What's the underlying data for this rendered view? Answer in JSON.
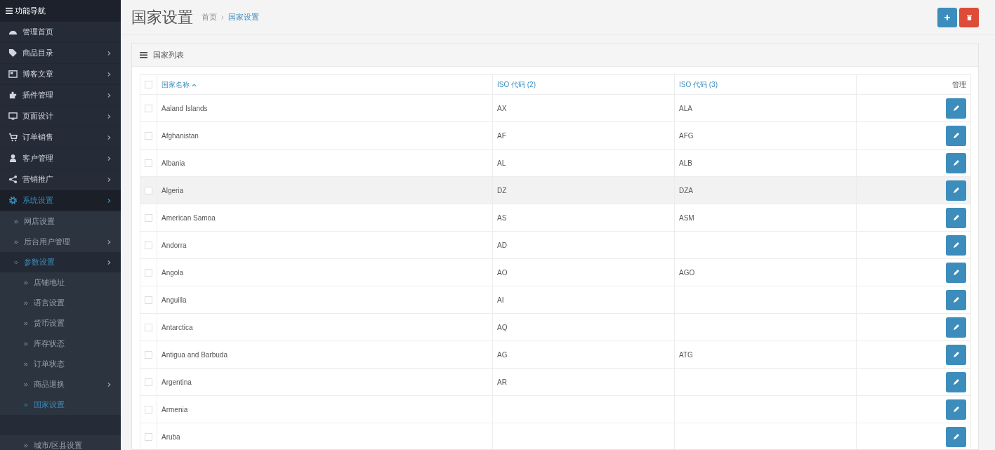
{
  "sidebar": {
    "title": "功能导航",
    "items": [
      {
        "label": "管理首页",
        "expandable": false,
        "selected": false
      },
      {
        "label": "商品目录",
        "expandable": true,
        "selected": false
      },
      {
        "label": "博客文章",
        "expandable": true,
        "selected": false
      },
      {
        "label": "插件管理",
        "expandable": true,
        "selected": false
      },
      {
        "label": "页面设计",
        "expandable": true,
        "selected": false
      },
      {
        "label": "订单销售",
        "expandable": true,
        "selected": false
      },
      {
        "label": "客户管理",
        "expandable": true,
        "selected": false
      },
      {
        "label": "营销推广",
        "expandable": true,
        "selected": false
      },
      {
        "label": "系统设置",
        "expandable": true,
        "selected": true,
        "expanded": true,
        "children": [
          {
            "label": "网店设置",
            "expandable": false,
            "selected": false
          },
          {
            "label": "后台用户管理",
            "expandable": true,
            "selected": false
          },
          {
            "label": "参数设置",
            "expandable": true,
            "selected": true,
            "expanded": true,
            "children": [
              {
                "label": "店铺地址",
                "expandable": false,
                "selected": false
              },
              {
                "label": "语言设置",
                "expandable": false,
                "selected": false
              },
              {
                "label": "货币设置",
                "expandable": false,
                "selected": false
              },
              {
                "label": "库存状态",
                "expandable": false,
                "selected": false
              },
              {
                "label": "订单状态",
                "expandable": false,
                "selected": false
              },
              {
                "label": "商品退换",
                "expandable": true,
                "selected": false
              },
              {
                "label": "国家设置",
                "expandable": false,
                "selected": true
              },
              {
                "label": "城市/区县设置",
                "expandable": false,
                "selected": false
              }
            ]
          }
        ]
      }
    ]
  },
  "page": {
    "title": "国家设置",
    "breadcrumb": [
      {
        "label": "首页",
        "selected": false
      },
      {
        "label": "国家设置",
        "selected": true
      }
    ]
  },
  "panel": {
    "title": "国家列表"
  },
  "table": {
    "header_checked": false,
    "columns": [
      {
        "label": "国家名称",
        "sorted": true
      },
      {
        "label": "ISO 代码 (2)",
        "sorted": false
      },
      {
        "label": "ISO 代码 (3)",
        "sorted": false
      },
      {
        "label": "管理",
        "sorted": false
      }
    ],
    "rows": [
      {
        "name": "Aaland Islands",
        "iso2": "AX",
        "iso3": "ALA",
        "checked": false,
        "highlighted": false
      },
      {
        "name": "Afghanistan",
        "iso2": "AF",
        "iso3": "AFG",
        "checked": false,
        "highlighted": false
      },
      {
        "name": "Albania",
        "iso2": "AL",
        "iso3": "ALB",
        "checked": false,
        "highlighted": false
      },
      {
        "name": "Algeria",
        "iso2": "DZ",
        "iso3": "DZA",
        "checked": false,
        "highlighted": true
      },
      {
        "name": "American Samoa",
        "iso2": "AS",
        "iso3": "ASM",
        "checked": false,
        "highlighted": false
      },
      {
        "name": "Andorra",
        "iso2": "AD",
        "checked": false,
        "highlighted": false
      },
      {
        "name": "Angola",
        "iso2": "AO",
        "iso3": "AGO",
        "checked": false,
        "highlighted": false
      },
      {
        "name": "Anguilla",
        "iso2": "AI",
        "checked": false,
        "highlighted": false
      },
      {
        "name": "Antarctica",
        "iso2": "AQ",
        "checked": false,
        "highlighted": false
      },
      {
        "name": "Antigua and Barbuda",
        "iso2": "AG",
        "iso3": "ATG",
        "checked": false,
        "highlighted": false
      },
      {
        "name": "Argentina",
        "iso2": "AR",
        "checked": false,
        "highlighted": false
      },
      {
        "name": "Armenia",
        "checked": false,
        "highlighted": false
      },
      {
        "name": "Aruba",
        "checked": false,
        "highlighted": false
      }
    ]
  }
}
